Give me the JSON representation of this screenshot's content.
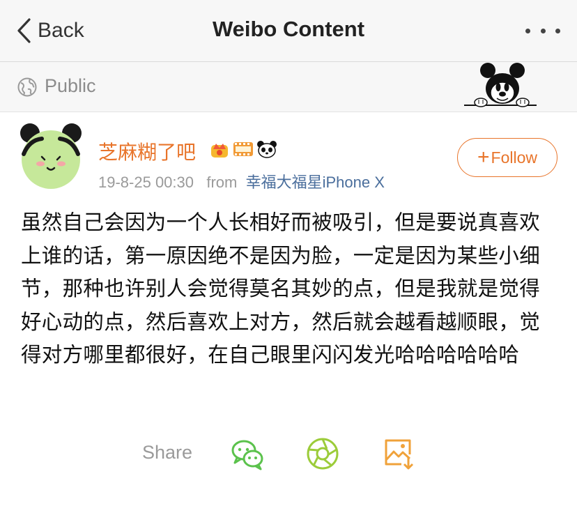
{
  "navbar": {
    "back_label": "Back",
    "title": "Weibo Content"
  },
  "visibility": {
    "label": "Public"
  },
  "post": {
    "author": "芝麻糊了吧",
    "timestamp": "19-8-25 00:30",
    "from_label": "from",
    "source": "幸福大福星iPhone X",
    "follow_label": "Follow",
    "text": "虽然自己会因为一个人长相好而被吸引，但是要说真喜欢上谁的话，第一原因绝不是因为脸，一定是因为某些小细节，那种也许别人会觉得莫名其妙的点，但是我就是觉得好心动的点，然后喜欢上对方，然后就会越看越顺眼，觉得对方哪里都很好，在自己眼里闪闪发光哈哈哈哈哈哈"
  },
  "share": {
    "label": "Share",
    "icons": [
      "wechat-icon",
      "moments-icon",
      "save-image-icon"
    ]
  },
  "colors": {
    "accent": "#e8742a",
    "link": "#4a6e9c",
    "wechat_green": "#5bc24c",
    "moments_green": "#9ccc3a",
    "save_orange": "#f0a23a"
  }
}
